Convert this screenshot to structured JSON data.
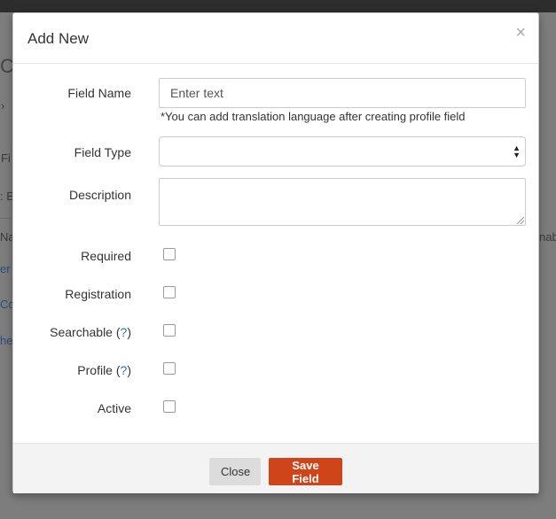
{
  "background": {
    "fragments": [
      "CO",
      "›",
      "Fi",
      ": E",
      "Na",
      "er",
      "Co",
      "he",
      "nab"
    ]
  },
  "modal": {
    "title": "Add New",
    "close_icon": "close-icon",
    "fields": {
      "field_name": {
        "label": "Field Name",
        "placeholder": "Enter text",
        "value": "",
        "hint": "*You can add translation language after creating profile field"
      },
      "field_type": {
        "label": "Field Type",
        "selected": ""
      },
      "description": {
        "label": "Description",
        "value": ""
      },
      "required": {
        "label": "Required",
        "checked": false
      },
      "registration": {
        "label": "Registration",
        "checked": false
      },
      "searchable": {
        "label": "Searchable",
        "help": "?",
        "checked": false
      },
      "profile": {
        "label": "Profile",
        "help": "?",
        "checked": false
      },
      "active": {
        "label": "Active",
        "checked": false
      }
    },
    "footer": {
      "close_label": "Close",
      "save_label": "Save Field"
    }
  },
  "colors": {
    "accent": "#d0441a",
    "link": "#2a6fb0"
  }
}
